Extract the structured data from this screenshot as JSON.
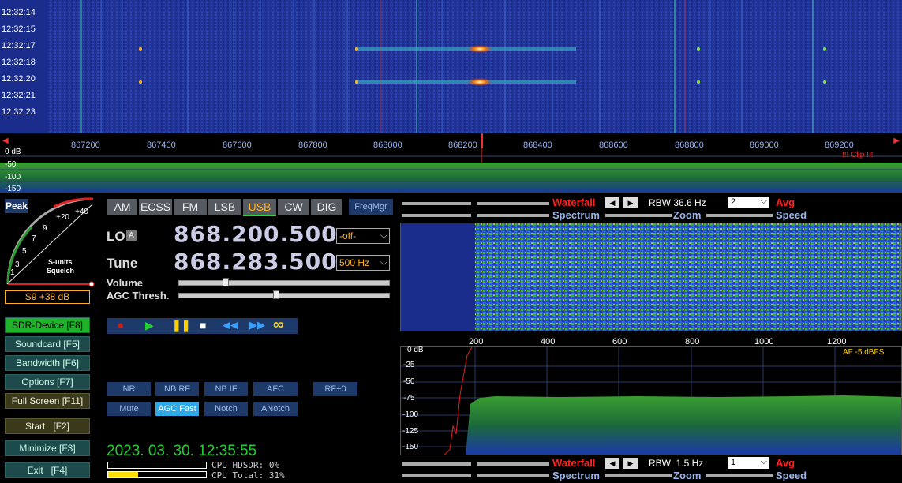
{
  "waterfall_times": [
    "12:32:14",
    "12:32:15",
    "12:32:17",
    "12:32:18",
    "12:32:20",
    "12:32:21",
    "12:32:23"
  ],
  "freq_ticks": [
    "867200",
    "867400",
    "867600",
    "867800",
    "868000",
    "868200",
    "868400",
    "868600",
    "868800",
    "869000",
    "869200"
  ],
  "top_spectrum": {
    "db_zero": "0 dB",
    "db_labels": [
      "-50",
      "-100",
      "-150"
    ],
    "clip": "!!! Clip !!!"
  },
  "smeter": {
    "peak_label": "Peak",
    "scale": [
      "+40",
      "+20",
      "9",
      "7",
      "5",
      "3",
      "1"
    ],
    "sunits": "S-units",
    "squelch": "Squelch",
    "reading": "S9 +38 dB"
  },
  "modes": [
    "AM",
    "ECSS",
    "FM",
    "LSB",
    "USB",
    "CW",
    "DIG"
  ],
  "freqmgr": "FreqMgr",
  "lo": {
    "label": "LO",
    "badge": "A",
    "value": "868.200.500",
    "select": "-off-"
  },
  "tune": {
    "label": "Tune",
    "value": "868.283.500",
    "select": "500 Hz"
  },
  "volume_label": "Volume",
  "agc_label": "AGC Thresh.",
  "side_buttons": [
    "SDR-Device [F8]",
    "Soundcard [F5]",
    "Bandwidth [F6]",
    "Options [F7]",
    "Full Screen [F11]",
    "Start   [F2]",
    "Minimize [F3]",
    "Exit   [F4]"
  ],
  "func_row1": [
    "NR",
    "NB RF",
    "NB IF",
    "AFC",
    "RF+0"
  ],
  "func_row2": [
    "Mute",
    "AGC Fast",
    "Notch",
    "ANotch"
  ],
  "datetime": "2023. 03. 30. 12:35:55",
  "cpu": {
    "hdsdr": "CPU HDSDR: 0%",
    "total": "CPU Total: 31%"
  },
  "upper_panel": {
    "waterfall": "Waterfall",
    "rbw": "RBW 36.6 Hz",
    "avg_select": "2",
    "avg": "Avg",
    "spectrum": "Spectrum",
    "zoom": "Zoom",
    "speed": "Speed"
  },
  "audio_axis": [
    "200",
    "400",
    "600",
    "800",
    "1000",
    "1200"
  ],
  "audio_spectrum": {
    "db_zero": "0 dB",
    "db_labels": [
      "-25",
      "-50",
      "-75",
      "-100",
      "-125",
      "-150"
    ],
    "af": "AF  -5 dBFS"
  },
  "lower_panel": {
    "waterfall": "Waterfall",
    "rbw": "RBW  1.5 Hz",
    "avg_select": "1",
    "avg": "Avg",
    "spectrum": "Spectrum",
    "zoom": "Zoom",
    "speed": "Speed"
  },
  "colors": {
    "accent_red": "#ff2020",
    "label_blue": "#9ab4e8",
    "green": "#1fb32a",
    "mode_sel": "#ffb020"
  }
}
